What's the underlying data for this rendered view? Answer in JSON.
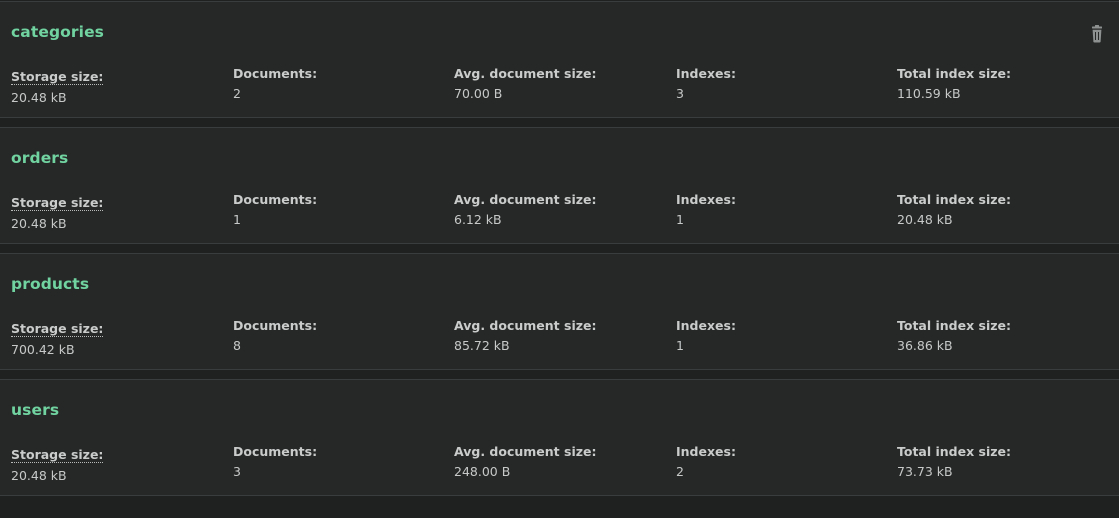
{
  "colors": {
    "page_background": "#1f2121",
    "card_background": "#262828",
    "title_accent": "#70d3a0",
    "text": "#c9cccb"
  },
  "trash_icon": "trash-icon",
  "collections": [
    {
      "name": "categories",
      "show_delete": true,
      "stats": [
        {
          "label": "Storage size:",
          "value": "20.48 kB"
        },
        {
          "label": "Documents:",
          "value": "2"
        },
        {
          "label": "Avg. document size:",
          "value": "70.00 B"
        },
        {
          "label": "Indexes:",
          "value": "3"
        },
        {
          "label": "Total index size:",
          "value": "110.59 kB"
        }
      ]
    },
    {
      "name": "orders",
      "show_delete": false,
      "stats": [
        {
          "label": "Storage size:",
          "value": "20.48 kB"
        },
        {
          "label": "Documents:",
          "value": "1"
        },
        {
          "label": "Avg. document size:",
          "value": "6.12 kB"
        },
        {
          "label": "Indexes:",
          "value": "1"
        },
        {
          "label": "Total index size:",
          "value": "20.48 kB"
        }
      ]
    },
    {
      "name": "products",
      "show_delete": false,
      "stats": [
        {
          "label": "Storage size:",
          "value": "700.42 kB"
        },
        {
          "label": "Documents:",
          "value": "8"
        },
        {
          "label": "Avg. document size:",
          "value": "85.72 kB"
        },
        {
          "label": "Indexes:",
          "value": "1"
        },
        {
          "label": "Total index size:",
          "value": "36.86 kB"
        }
      ]
    },
    {
      "name": "users",
      "show_delete": false,
      "stats": [
        {
          "label": "Storage size:",
          "value": "20.48 kB"
        },
        {
          "label": "Documents:",
          "value": "3"
        },
        {
          "label": "Avg. document size:",
          "value": "248.00 B"
        },
        {
          "label": "Indexes:",
          "value": "2"
        },
        {
          "label": "Total index size:",
          "value": "73.73 kB"
        }
      ]
    }
  ]
}
